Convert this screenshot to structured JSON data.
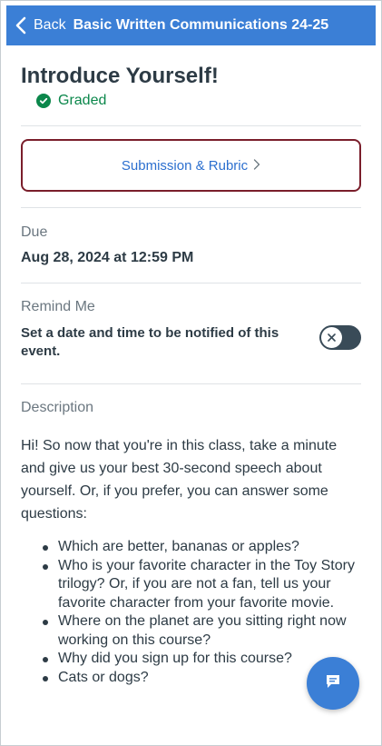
{
  "header": {
    "back_label": "Back",
    "course_title": "Basic Written Communications 24-25"
  },
  "assignment": {
    "title": "Introduce Yourself!",
    "status": "Graded"
  },
  "submission": {
    "link_label": "Submission & Rubric"
  },
  "due": {
    "label": "Due",
    "value": "Aug 28, 2024 at 12:59 PM"
  },
  "remind": {
    "label": "Remind Me",
    "text": "Set a date and time to be notified of this event.",
    "toggle_state": "off"
  },
  "description": {
    "label": "Description",
    "body": "Hi! So now that you're in this class, take a minute and give us your best 30-second speech about yourself. Or, if you prefer, you can answer some questions:",
    "questions": [
      "Which are better, bananas or apples?",
      "Who is your favorite character in the Toy Story trilogy? Or, if you are not a fan, tell us your favorite character from your favorite movie.",
      "Where on the planet are you sitting right now working on this course?",
      "Why did you sign up for this course?",
      "Cats or dogs?"
    ]
  },
  "icons": {
    "back": "chevron-left-icon",
    "graded": "check-circle-icon",
    "rubric_chevron": "chevron-right-icon",
    "toggle": "x-icon",
    "fab": "chat-icon"
  },
  "colors": {
    "header_bg": "#3b7fd6",
    "graded": "#0b874b",
    "link": "#2b6fcf",
    "highlight_border": "#7a1e2b",
    "toggle_bg": "#394b58"
  }
}
